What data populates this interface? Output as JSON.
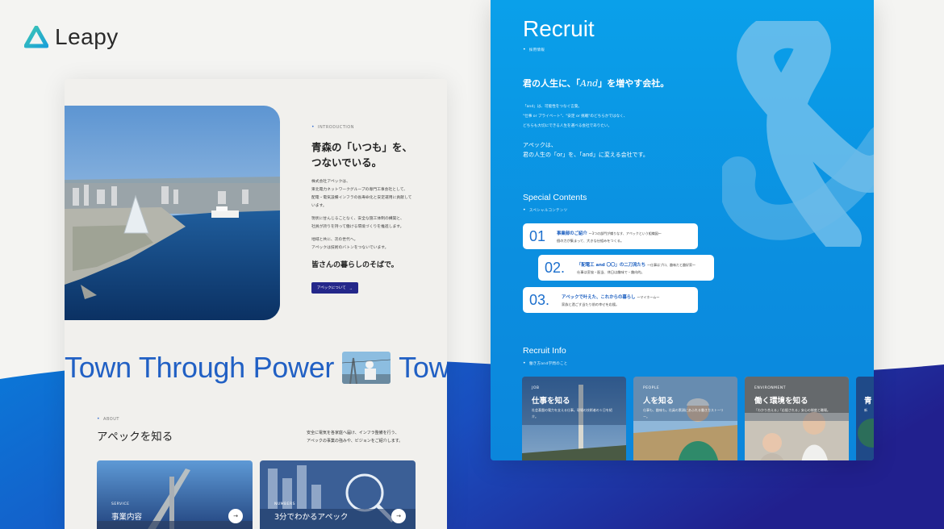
{
  "brand": {
    "name": "Leapy"
  },
  "left": {
    "intro": {
      "eyebrow": "INTRODUCTION",
      "title_line1": "青森の「いつも」を、",
      "title_line2": "つないでいる。",
      "p1": [
        "株式会社アペックは、",
        "東北電力ネットワークグループの専門工事会社として、",
        "配電・電気設備インフラの長寿命化と安定運用に貢献して",
        "います。"
      ],
      "p2": [
        "現状に甘んじることなく、安全な施工体制の構築と、",
        "社員が誇りを持って働ける環境づくりを推進します。"
      ],
      "p3": [
        "地域と共に、次の世代へ。",
        "アペックは技術のバトンをつないでいます。"
      ],
      "closing": "皆さんの暮らしのそばで。",
      "button": "アペックについて",
      "button_arrow": "→"
    },
    "ticker": {
      "text": "Town Through Power",
      "text_repeat": "Tow"
    },
    "about": {
      "eyebrow": "ABOUT",
      "title": "アペックを知る",
      "desc_line1": "安全に電気を各家庭へ届け、インフラ整備を行う、",
      "desc_line2": "アペックの事業の強みや、ビジョンをご紹介します。",
      "cards": [
        {
          "sub": "SERVICE",
          "title": "事業内容",
          "arrow": "→"
        },
        {
          "sub": "NUMBERS",
          "title": "3分でわかるアペック",
          "arrow": "→"
        }
      ]
    }
  },
  "right": {
    "title": "Recruit",
    "eyebrow": "採用情報",
    "lead_pre": "君の人生に、「",
    "lead_and": "And",
    "lead_post": "」を増やす会社。",
    "body": [
      "「and」は、可能性をつなぐ言葉。",
      "\"仕事 or プライベート\"、\"安定 or 挑戦\"のどちらかではなく、",
      "どちらも大切にできる人生を選べる会社でありたい。"
    ],
    "strong_line1": "アペックは、",
    "strong_line2": "君の人生の「or」を、「and」に変える会社です。",
    "special": {
      "heading": "Special Contents",
      "eyebrow": "スペシャルコンテンツ",
      "items": [
        {
          "num": "01",
          "title": "事業部のご紹介",
          "title_small": "〜3つの部門が織りなす、アペックという組織図〜",
          "desc": "個の力が集まって、大きな仕組みをつくる。"
        },
        {
          "num": "02.",
          "title": "「配電工 and 〇〇」の二刀流たち",
          "title_small": "〜仕事はプロ、趣味だと趣好家〜",
          "desc": "仕事は妥協・配当、休日は趣味で・趣向的。"
        },
        {
          "num": "03.",
          "title": "アペックで叶えた、これからの暮らし",
          "title_small": "〜マイホーム〜",
          "desc": "家族と過ごす当たり前の幸せを応援。"
        }
      ]
    },
    "info": {
      "heading": "Recruit Info",
      "eyebrow": "働き方and学問のこと",
      "cards": [
        {
          "sub": "JOB",
          "title": "仕事を知る",
          "desc": "社会基盤の電力を支える仕事。現場の技術者の１日を紹介。"
        },
        {
          "sub": "PEOPLE",
          "title": "人を知る",
          "desc": "仕事も、趣味も。社員の素顔にあふれる働き方ストーリー。"
        },
        {
          "sub": "ENVIRONMENT",
          "title": "働く環境を知る",
          "desc": "「わかり合える」「応援される」安心の制度と職場。"
        },
        {
          "sub": "",
          "title": "青",
          "desc": "新"
        }
      ]
    }
  }
}
